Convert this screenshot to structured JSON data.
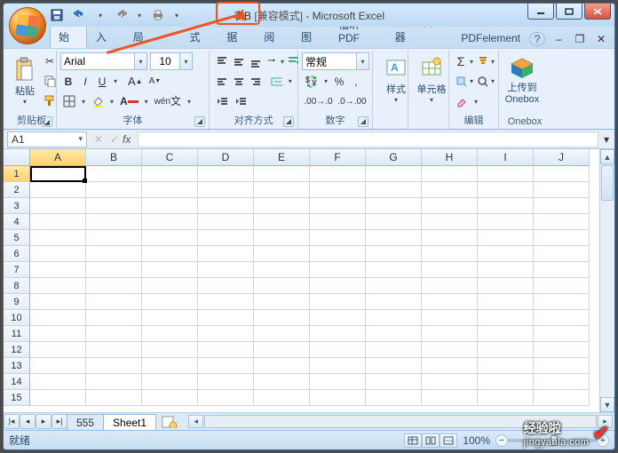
{
  "title": {
    "doc": "表B",
    "mode": "[兼容模式]",
    "sep": " - ",
    "app": "Microsoft Excel"
  },
  "tabs": {
    "home": "开始",
    "insert": "插入",
    "layout": "页面布局",
    "formulas": "公式",
    "data": "数据",
    "review": "审阅",
    "view": "视图",
    "foxitpdf": "福昕PDF",
    "foxitreader": "福昕阅读器",
    "pdfelement": "PDFelement"
  },
  "groups": {
    "clipboard": {
      "label": "剪贴板",
      "paste": "粘贴"
    },
    "font": {
      "label": "字体",
      "name": "Arial",
      "size": "10",
      "wen": "wén",
      "bold": "B",
      "italic": "I",
      "underline": "U"
    },
    "align": {
      "label": "对齐方式"
    },
    "number": {
      "label": "数字",
      "format": "常规"
    },
    "styles": {
      "label": "样式",
      "btn": "样式"
    },
    "cells": {
      "label": "单元格",
      "btn": "单元格"
    },
    "editing": {
      "label": "编辑"
    },
    "onebox": {
      "label": "Onebox",
      "btn1": "上传到",
      "btn2": "Onebox"
    }
  },
  "namebox": "A1",
  "fx": "fx",
  "columns": [
    "A",
    "B",
    "C",
    "D",
    "E",
    "F",
    "G",
    "H",
    "I",
    "J"
  ],
  "rows": [
    "1",
    "2",
    "3",
    "4",
    "5",
    "6",
    "7",
    "8",
    "9",
    "10",
    "11",
    "12",
    "13",
    "14",
    "15"
  ],
  "activeCell": {
    "row": 0,
    "col": 0
  },
  "sheets": {
    "s1": "555",
    "s2": "Sheet1"
  },
  "status": {
    "ready": "就绪",
    "zoom": "100%"
  },
  "watermark": {
    "line1": "经验啦",
    "line2": "jingyanla.com"
  }
}
